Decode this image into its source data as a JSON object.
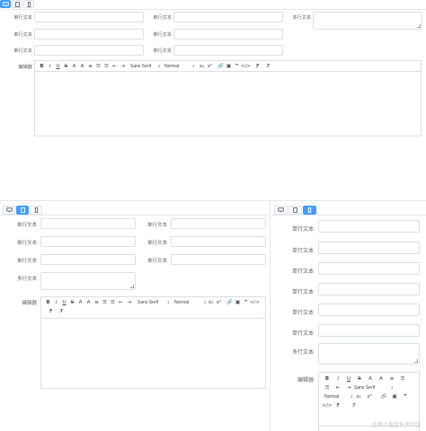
{
  "labels": {
    "single_line": "单行文本",
    "multi_line": "多行文本",
    "editor": "编辑器"
  },
  "toolbar": {
    "bold": "B",
    "italic": "I",
    "underline": "U",
    "strike": "S",
    "font_color": "A",
    "bg_color": "A",
    "align": "≡",
    "ordered_list": "☰",
    "bullet_list": "☰",
    "indent_left": "⇤",
    "indent_right": "⇥",
    "font_select": "Sans Serif",
    "size_select": "Normal",
    "subscript": "x₂",
    "superscript": "x²",
    "link": "🔗",
    "image": "▣",
    "quote": "❞",
    "code": "</>",
    "direction": "⁋",
    "clean": "T̸",
    "arrow": "⇕"
  },
  "watermark": "@稀土掘金技术社区"
}
